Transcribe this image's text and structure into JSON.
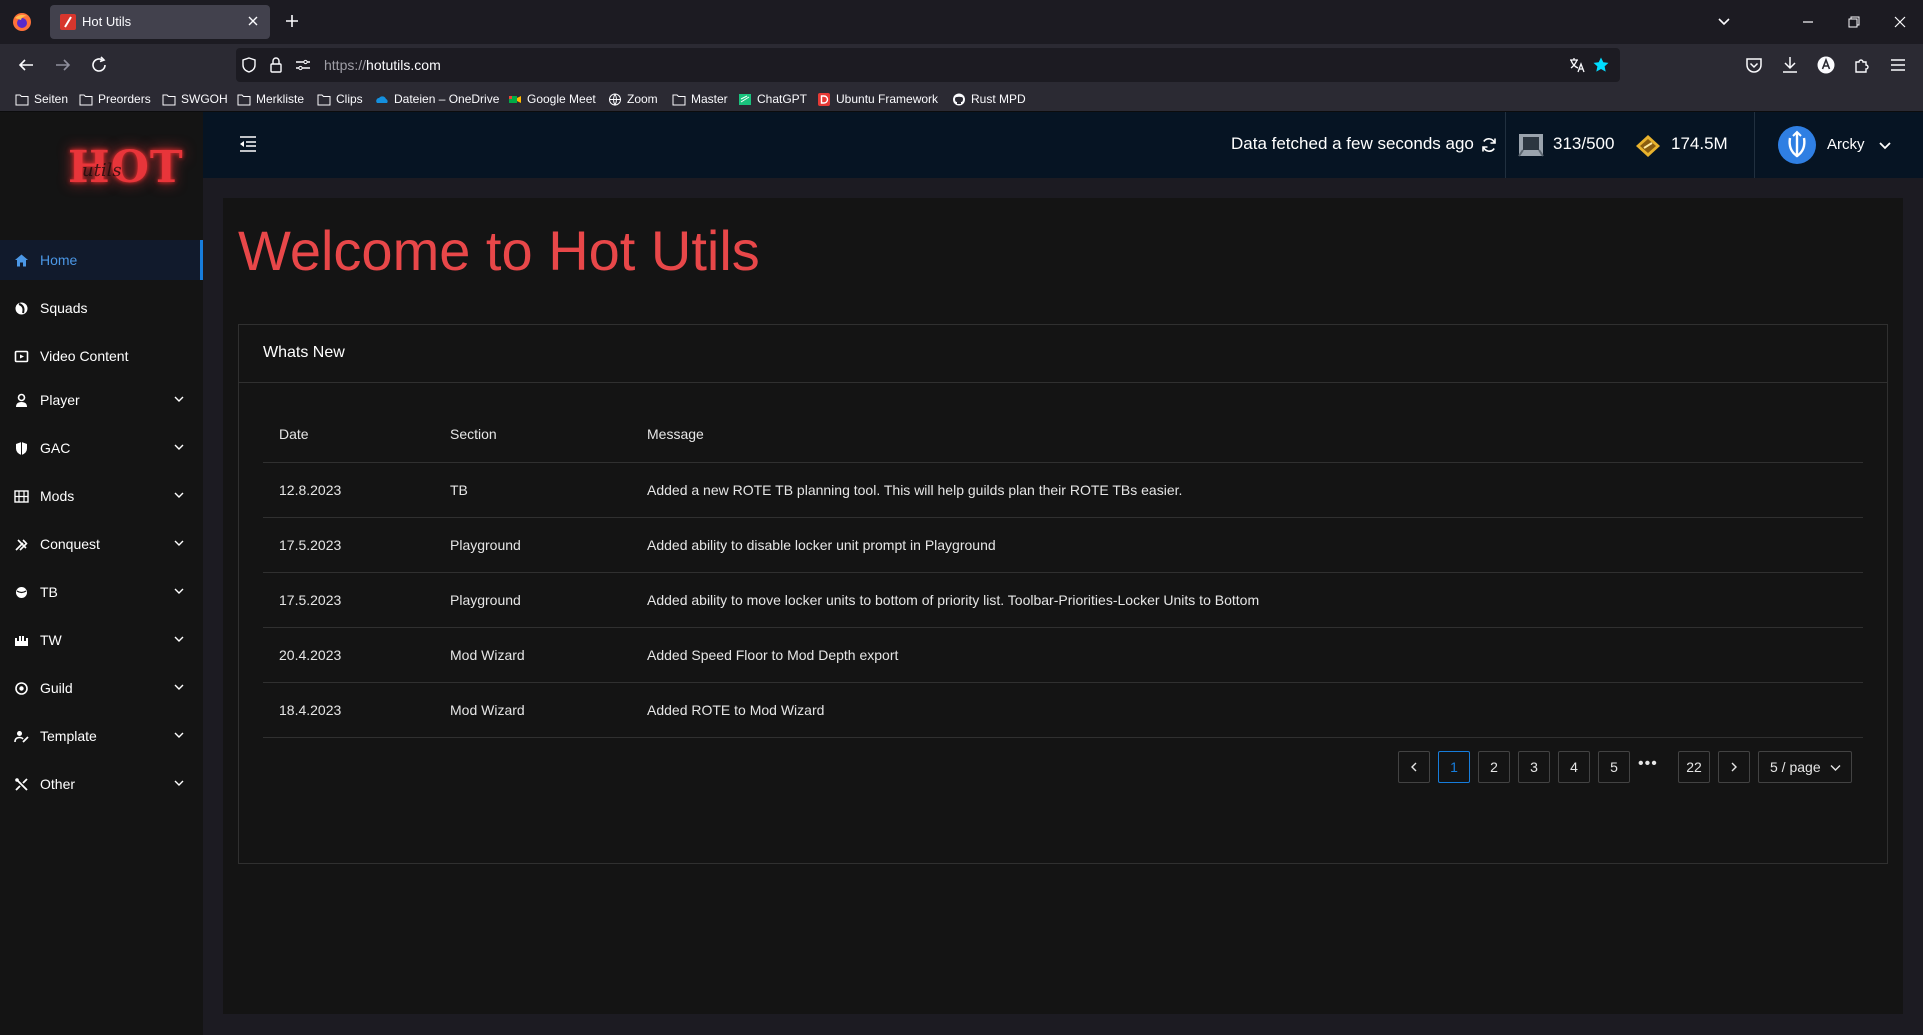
{
  "browser": {
    "tab_title": "Hot Utils",
    "url_scheme": "https://",
    "url_host": "hotutils.com",
    "bookmarks": [
      "Seiten",
      "Preorders",
      "SWGOH",
      "Merkliste",
      "Clips",
      "Dateien – OneDrive",
      "Google Meet",
      "Zoom",
      "Master",
      "ChatGPT",
      "Ubuntu Framework",
      "Rust MPD"
    ]
  },
  "header": {
    "logo_text": "HOT",
    "logo_script": "utils",
    "fetch_status": "Data fetched a few seconds ago",
    "energy": "313/500",
    "credits": "174.5M",
    "user_name": "Arcky"
  },
  "sidebar": {
    "items": [
      {
        "label": "Home",
        "icon": "home-icon",
        "active": true
      },
      {
        "label": "Squads",
        "icon": "squads-icon"
      },
      {
        "label": "Video Content",
        "icon": "video-icon"
      },
      {
        "label": "Player",
        "icon": "player-icon"
      },
      {
        "label": "GAC",
        "icon": "shield-icon"
      },
      {
        "label": "Mods",
        "icon": "mods-icon"
      },
      {
        "label": "Conquest",
        "icon": "conquest-icon"
      },
      {
        "label": "TB",
        "icon": "tb-icon"
      },
      {
        "label": "TW",
        "icon": "tw-icon"
      },
      {
        "label": "Guild",
        "icon": "guild-icon"
      },
      {
        "label": "Template",
        "icon": "template-icon"
      },
      {
        "label": "Other",
        "icon": "tools-icon"
      }
    ]
  },
  "main": {
    "title": "Welcome to Hot Utils",
    "card_title": "Whats New",
    "columns": [
      "Date",
      "Section",
      "Message"
    ],
    "rows": [
      [
        "12.8.2023",
        "TB",
        "Added a new ROTE TB planning tool. This will help guilds plan their ROTE TBs easier."
      ],
      [
        "17.5.2023",
        "Playground",
        "Added ability to disable locker unit prompt in Playground"
      ],
      [
        "17.5.2023",
        "Playground",
        "Added ability to move locker units to bottom of priority list. Toolbar-Priorities-Locker Units to Bottom"
      ],
      [
        "20.4.2023",
        "Mod Wizard",
        "Added Speed Floor to Mod Depth export"
      ],
      [
        "18.4.2023",
        "Mod Wizard",
        "Added ROTE to Mod Wizard"
      ]
    ],
    "pagination": {
      "pages": [
        "1",
        "2",
        "3",
        "4",
        "5"
      ],
      "ellipsis": "•••",
      "last_page": "22",
      "current": "1",
      "page_size": "5 / page"
    }
  },
  "colors": {
    "accent": "#177ddc",
    "title_red": "#e84749",
    "header_bg": "#061423",
    "sidebar_bg": "#141414"
  }
}
